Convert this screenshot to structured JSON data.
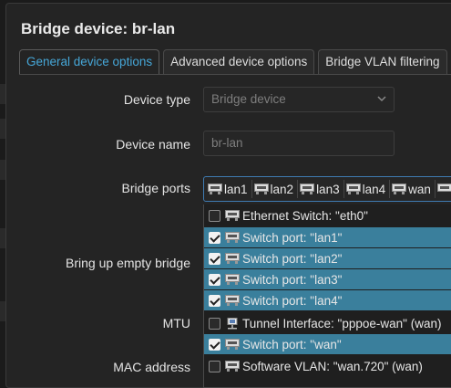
{
  "modal": {
    "title": "Bridge device: br-lan"
  },
  "tabs": [
    {
      "label": "General device options",
      "active": true
    },
    {
      "label": "Advanced device options",
      "active": false
    },
    {
      "label": "Bridge VLAN filtering",
      "active": false
    }
  ],
  "form": {
    "device_type": {
      "label": "Device type",
      "value": "Bridge device"
    },
    "device_name": {
      "label": "Device name",
      "value": "br-lan"
    },
    "bridge_ports": {
      "label": "Bridge ports",
      "selected": [
        "lan1",
        "lan2",
        "lan3",
        "lan4",
        "wan"
      ]
    },
    "bring_up_empty": {
      "label": "Bring up empty bridge"
    },
    "mtu": {
      "label": "MTU"
    },
    "mac_address": {
      "label": "MAC address"
    }
  },
  "dropdown": {
    "options": [
      {
        "label": "Ethernet Switch: \"eth0\"",
        "checked": false,
        "icon": "ethernet-port-icon"
      },
      {
        "label": "Switch port: \"lan1\"",
        "checked": true,
        "icon": "ethernet-port-icon"
      },
      {
        "label": "Switch port: \"lan2\"",
        "checked": true,
        "icon": "ethernet-port-icon"
      },
      {
        "label": "Switch port: \"lan3\"",
        "checked": true,
        "icon": "ethernet-port-icon"
      },
      {
        "label": "Switch port: \"lan4\"",
        "checked": true,
        "icon": "ethernet-port-icon"
      },
      {
        "label": "Tunnel Interface: \"pppoe-wan\" (wan)",
        "checked": false,
        "icon": "tunnel-icon"
      },
      {
        "label": "Switch port: \"wan\"",
        "checked": true,
        "icon": "ethernet-port-icon"
      },
      {
        "label": "Software VLAN: \"wan.720\" (wan)",
        "checked": false,
        "icon": "ethernet-port-icon"
      }
    ]
  },
  "colors": {
    "accent": "#46a7d8",
    "selected_row": "#3a7f9c",
    "focus_border": "#3f7bb1"
  }
}
